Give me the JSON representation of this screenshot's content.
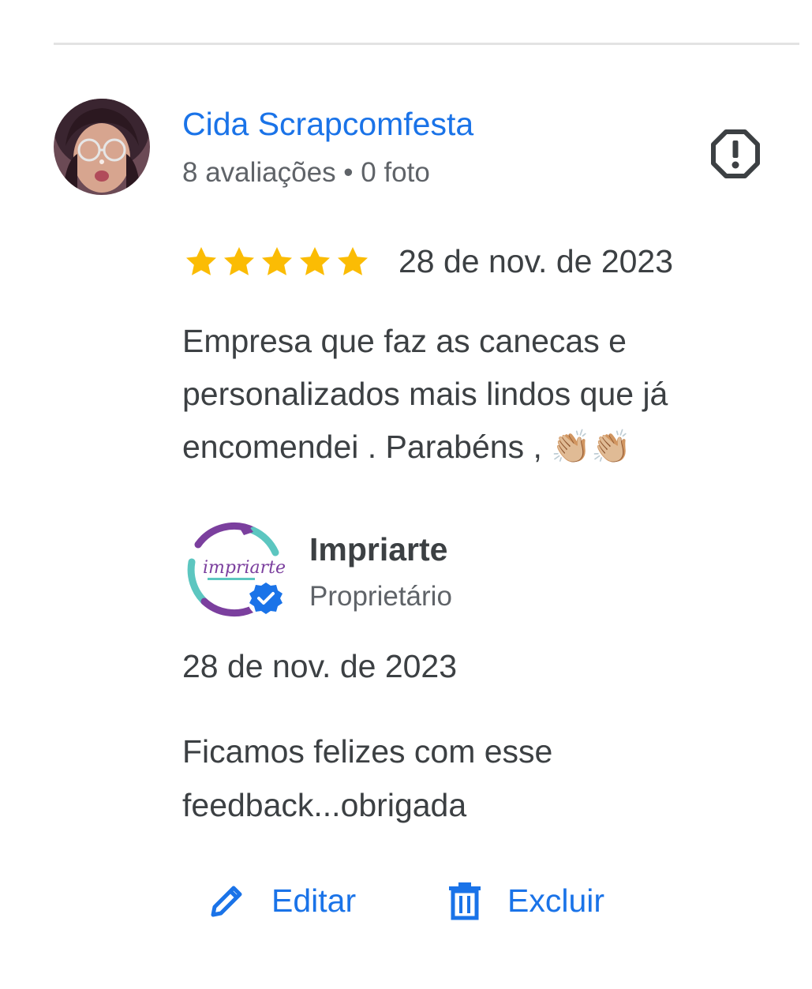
{
  "review": {
    "reviewer_name": "Cida Scrapcomfesta",
    "reviewer_meta": "8 avaliações • 0 foto",
    "rating": 5,
    "rating_max": 5,
    "date": "28 de nov. de 2023",
    "text_lines": [
      "Empresa que faz as canecas e",
      "personalizados mais lindos que já",
      "encomendei . Parabéns , 👏🏼👏🏼"
    ],
    "report_icon": "flag-alert-icon"
  },
  "owner_reply": {
    "name": "Impriarte",
    "role": "Proprietário",
    "date": "28 de nov. de 2023",
    "text_lines": [
      "Ficamos felizes com esse",
      "feedback...obrigada"
    ],
    "verified_icon": "verified-check-icon"
  },
  "actions": {
    "edit_label": "Editar",
    "edit_icon": "pencil-icon",
    "delete_label": "Excluir",
    "delete_icon": "trash-icon"
  },
  "colors": {
    "accent": "#1a73e8",
    "star": "#fbbc04",
    "text": "#3c4043",
    "secondary_text": "#5f6368",
    "divider": "#e3e3e3"
  }
}
